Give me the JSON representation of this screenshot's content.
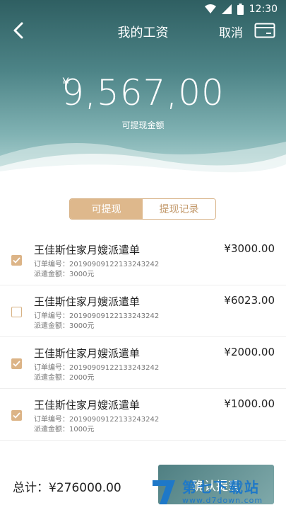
{
  "status_bar": {
    "time": "12:30"
  },
  "nav": {
    "title": "我的工资",
    "cancel_label": "取消"
  },
  "balance": {
    "currency": "¥",
    "amount": "9,567,00",
    "label": "可提现金额"
  },
  "tabs": [
    {
      "label": "可提现",
      "active": true
    },
    {
      "label": "提现记录",
      "active": false
    }
  ],
  "orders": [
    {
      "title": "王佳斯住家月嫂派遣单",
      "order_no": "订单编号：20190909122133243242",
      "dispatch_amount": "派遣金额：3000元",
      "price": "¥3000.00",
      "checked": true
    },
    {
      "title": "王佳斯住家月嫂派遣单",
      "order_no": "订单编号：20190909122133243242",
      "dispatch_amount": "派遣金额：3000元",
      "price": "¥6023.00",
      "checked": false
    },
    {
      "title": "王佳斯住家月嫂派遣单",
      "order_no": "订单编号：20190909122133243242",
      "dispatch_amount": "派遣金额：2000元",
      "price": "¥2000.00",
      "checked": true
    },
    {
      "title": "王佳斯住家月嫂派遣单",
      "order_no": "订单编号：20190909122133243242",
      "dispatch_amount": "派遣金额：1000元",
      "price": "¥1000.00",
      "checked": true
    }
  ],
  "footer": {
    "total": "总计：¥276000.00",
    "confirm_label": "确认提现"
  },
  "watermark": {
    "name": "第七下载站",
    "url": "www.d7down.com"
  },
  "colors": {
    "accent": "#deb88c",
    "header_dark": "#2f5f62",
    "header_light": "#b3d6d5",
    "watermark": "#1e78c8"
  },
  "icons": {
    "back": "chevron-left-icon",
    "card": "card-icon",
    "wifi": "wifi-icon",
    "signal": "signal-icon",
    "battery": "battery-icon",
    "check": "check-icon"
  }
}
